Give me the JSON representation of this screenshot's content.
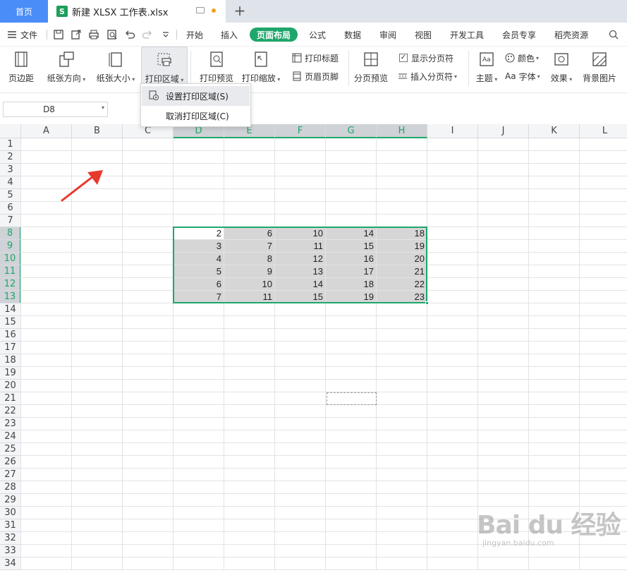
{
  "titlebar": {
    "home_tab": "首页",
    "doc_icon_letter": "S",
    "doc_name": "新建 XLSX 工作表.xlsx",
    "new_tab_symbol": "+"
  },
  "menubar": {
    "file_label": "文件",
    "tabs": [
      "开始",
      "插入",
      "页面布局",
      "公式",
      "数据",
      "审阅",
      "视图",
      "开发工具",
      "会员专享",
      "稻壳资源"
    ],
    "active_tab": "页面布局"
  },
  "ribbon": {
    "margins": "页边距",
    "orientation": "纸张方向",
    "size": "纸张大小",
    "print_area": "打印区域",
    "print_preview": "打印预览",
    "print_scale": "打印缩放",
    "print_titles": "打印标题",
    "header_footer": "页眉页脚",
    "page_break_preview": "分页预览",
    "show_page_breaks": "显示分页符",
    "insert_page_break": "插入分页符",
    "theme": "主题",
    "colors": "颜色",
    "fonts": "字体",
    "fonts_prefix": "Aa",
    "effects": "效果",
    "background": "背景图片"
  },
  "namebox": {
    "value": "D8"
  },
  "dropdown": {
    "items": [
      "设置打印区域(S)",
      "取消打印区域(C)"
    ]
  },
  "columns": [
    "A",
    "B",
    "C",
    "D",
    "E",
    "F",
    "G",
    "H",
    "I",
    "J",
    "K",
    "L"
  ],
  "selected_columns": [
    "D",
    "E",
    "F",
    "G",
    "H"
  ],
  "rows": [
    "1",
    "2",
    "3",
    "4",
    "5",
    "6",
    "7",
    "8",
    "9",
    "10",
    "11",
    "12",
    "13",
    "14",
    "15",
    "16",
    "17",
    "18",
    "19",
    "20",
    "21",
    "22",
    "23",
    "24",
    "25",
    "26",
    "27",
    "28",
    "29",
    "30",
    "31",
    "32",
    "33",
    "34"
  ],
  "selected_rows": [
    "8",
    "9",
    "10",
    "11",
    "12",
    "13"
  ],
  "data_table": [
    [
      2,
      6,
      10,
      14,
      18
    ],
    [
      3,
      7,
      11,
      15,
      19
    ],
    [
      4,
      8,
      12,
      16,
      20
    ],
    [
      5,
      9,
      13,
      17,
      21
    ],
    [
      6,
      10,
      14,
      18,
      22
    ],
    [
      7,
      11,
      15,
      19,
      23
    ]
  ],
  "watermark": {
    "main": "Bai du 经验",
    "sub": "jingyan.baidu.com"
  },
  "colors": {
    "accent": "#1fa66b",
    "home_tab": "#4a8df8",
    "arrow": "#e8392e"
  }
}
